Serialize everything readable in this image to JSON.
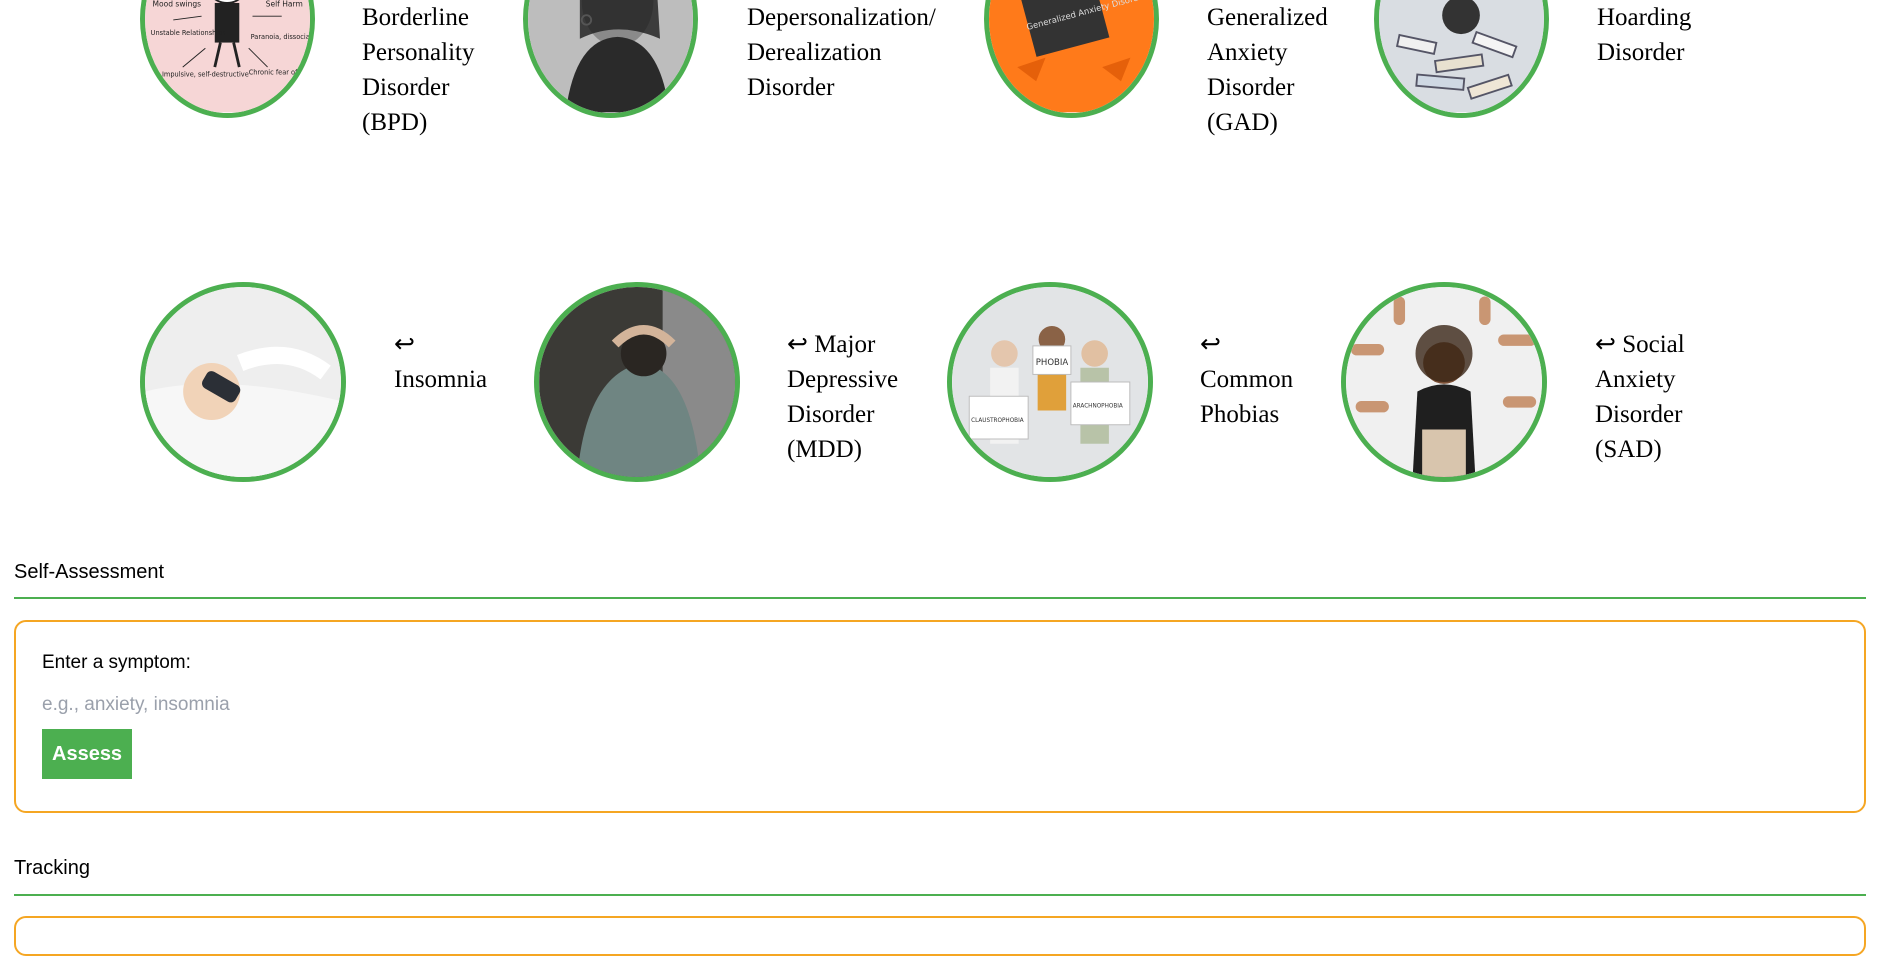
{
  "conditions_row1": [
    {
      "label": "Borderline Personality Disorder (BPD)",
      "image": "bpd-diagram-illustration"
    },
    {
      "label": "Depersonalization/ Derealization Disorder",
      "image": "woman-portrait-bw"
    },
    {
      "label": "Generalized Anxiety Disorder (GAD)",
      "image": "anxiety-sign-orange"
    },
    {
      "label": "Hoarding Disorder",
      "image": "stacked-papers"
    }
  ],
  "conditions_row2": [
    {
      "label": "↩ Insomnia",
      "image": "woman-in-bed-sleep-mask"
    },
    {
      "label": "↩ Major Depressive Disorder (MDD)",
      "image": "person-head-in-hands"
    },
    {
      "label": "↩ Common Phobias",
      "image": "people-holding-phobia-signs"
    },
    {
      "label": "↩ Social Anxiety Disorder (SAD)",
      "image": "woman-surrounded-by-pointing-hands"
    }
  ],
  "bpd_diagram_text": [
    "Mood swings",
    "Self Harm",
    "Unstable Relationships",
    "Paranoia, dissociation",
    "Chronic fear of empti",
    "Impulsive, self-destructive"
  ],
  "gad_sign_text": "Generalized Anxiety Disorder",
  "phobia_signs": [
    "PHOBIA",
    "CLAUSTROPHOBIA",
    "ARACHNOPHOBIA"
  ],
  "self_assessment": {
    "title": "Self-Assessment",
    "field_label": "Enter a symptom:",
    "placeholder": "e.g., anxiety, insomnia",
    "button_label": "Assess"
  },
  "tracking": {
    "title": "Tracking"
  },
  "colors": {
    "accent_green": "#4caf50",
    "panel_border": "#f5a623"
  }
}
